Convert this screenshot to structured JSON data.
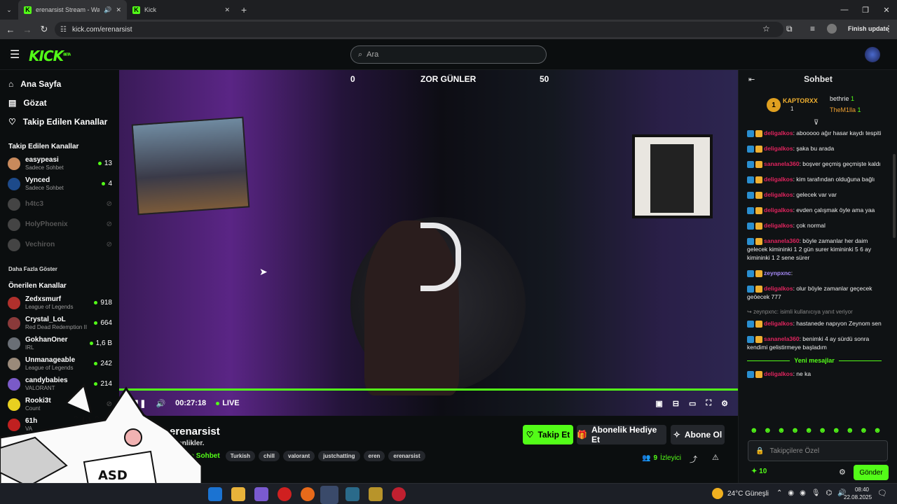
{
  "browser": {
    "tabs": [
      {
        "title": "erenarsist Stream - Watch L"
      },
      {
        "title": "Kick"
      }
    ],
    "url": "kick.com/erenarsist",
    "finish_update": "Finish update"
  },
  "header": {
    "logo": "KICK",
    "logo_badge": "BETA",
    "search_placeholder": "Ara"
  },
  "nav": [
    {
      "label": "Ana Sayfa",
      "icon": "home-icon"
    },
    {
      "label": "Gözat",
      "icon": "browse-icon"
    },
    {
      "label": "Takip Edilen Kanallar",
      "icon": "heart-icon"
    }
  ],
  "followed": {
    "title": "Takip Edilen Kanallar",
    "items": [
      {
        "name": "easypeasi",
        "sub": "Sadece Sohbet",
        "viewers": "13",
        "color": "#c98a5c"
      },
      {
        "name": "Vynced",
        "sub": "Sadece Sohbet",
        "viewers": "4",
        "color": "#1d4a8a"
      },
      {
        "name": "h4tc3",
        "sub": "",
        "viewers": "",
        "color": "#444"
      },
      {
        "name": "HolyPhoenix",
        "sub": "",
        "viewers": "",
        "color": "#444"
      },
      {
        "name": "Vechiron",
        "sub": "",
        "viewers": "",
        "color": "#444"
      }
    ],
    "more": "Daha Fazla Göster"
  },
  "recommended": {
    "title": "Önerilen Kanallar",
    "items": [
      {
        "name": "Zedxsmurf",
        "sub": "League of Legends",
        "viewers": "918",
        "color": "#b0302c"
      },
      {
        "name": "Crystal_LoL",
        "sub": "Red Dead Redemption II",
        "viewers": "664",
        "color": "#8a3a3a"
      },
      {
        "name": "GokhanOner",
        "sub": "IRL",
        "viewers": "1,6 B",
        "color": "#6a6f76"
      },
      {
        "name": "Unmanageable",
        "sub": "League of Legends",
        "viewers": "242",
        "color": "#9a8a7a"
      },
      {
        "name": "candybabies",
        "sub": "VALORANT",
        "viewers": "214",
        "color": "#7a5ac8"
      },
      {
        "name": "Rooki3t",
        "sub": "Count",
        "viewers": "",
        "color": "#e8d020"
      },
      {
        "name": "61h",
        "sub": "VA",
        "viewers": "",
        "color": "#c02020"
      }
    ]
  },
  "video": {
    "overlay_left": "0",
    "overlay_title": "ZOR GÜNLER",
    "overlay_right": "50",
    "time": "00:27:18",
    "live": "LIVE",
    "progress": 1.0
  },
  "stream": {
    "channel": "erenarsist",
    "title": "Esenlikler.",
    "mode": "Sadece Sohbet",
    "tags": [
      "Turkish",
      "chill",
      "valorant",
      "justchatting",
      "eren",
      "erenarsist"
    ],
    "follow": "Takip Et",
    "gift": "Abonelik Hediye Et",
    "subscribe": "Abone Ol",
    "viewers": "9",
    "viewers_label": "İzleyici"
  },
  "chat": {
    "title": "Sohbet",
    "top": [
      {
        "name": "KAPTORXX",
        "count": "1"
      },
      {
        "name": "bethrie",
        "count": "1"
      },
      {
        "name": "TheM1lla",
        "count": "1"
      }
    ],
    "messages": [
      {
        "user": "deligalkos",
        "text": ": abooooo ağır hasar kaydı tespiti",
        "color": "#e0245e"
      },
      {
        "user": "deligalkos",
        "text": ": şaka bu arada",
        "color": "#e0245e"
      },
      {
        "user": "sananela360",
        "text": ": boşver geçmiş geçmişte kaldı",
        "color": "#e0245e"
      },
      {
        "user": "deligalkos",
        "text": ": kim tarafından olduğuna bağlı",
        "color": "#e0245e"
      },
      {
        "user": "deligalkos",
        "text": ": gelecek var var",
        "color": "#e0245e"
      },
      {
        "user": "deligalkos",
        "text": ": evden çalışmak öyle ama yaa",
        "color": "#e0245e"
      },
      {
        "user": "deligalkos",
        "text": ": çok normal",
        "color": "#e0245e"
      },
      {
        "user": "sananela360",
        "text": ": böyle zamanlar her daim gelecek kimininki 1 2 gün surer kimininki 5 6 ay kimininki 1 2 sene sürer",
        "color": "#e0245e"
      },
      {
        "user": "zeynpxnc",
        "text": ":",
        "color": "#a78bfa"
      },
      {
        "user": "deligalkos",
        "text": ": olur böyle zamanlar geçecek geöecek 777",
        "color": "#e0245e"
      }
    ],
    "reply_to": "zeynpxnc:",
    "reply_note": "isimli kullanıcıya yanıt veriyor",
    "messages2": [
      {
        "user": "deligalkos",
        "text": ": hastanede napıyon Zeynom sen",
        "color": "#e0245e"
      },
      {
        "user": "sananela360",
        "text": ": benimki 4 ay sürdü sonra kendimi gelistirmeye başladım",
        "color": "#e0245e"
      }
    ],
    "new_messages": "Yeni mesajlar",
    "last": {
      "user": "deligalkos",
      "text": ": ne ka",
      "color": "#e0245e"
    },
    "input_placeholder": "Takipçilere Özel",
    "points": "10",
    "send": "Gönder"
  },
  "taskbar": {
    "weather": "24°C",
    "weather_desc": "Güneşli",
    "time": "08:40",
    "date": "22.08.2025"
  },
  "sticker_text": "ASD"
}
